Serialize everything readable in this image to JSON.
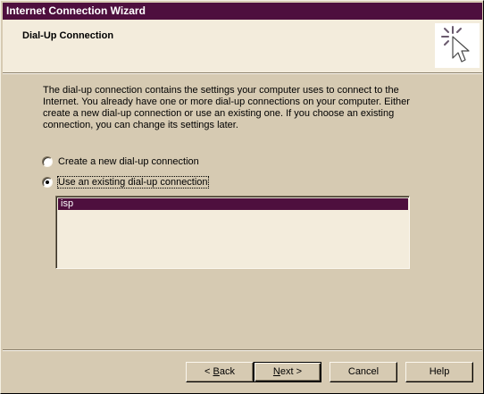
{
  "window": {
    "title": "Internet Connection Wizard"
  },
  "header": {
    "title": "Dial-Up Connection",
    "icon": "wizard-cursor-icon"
  },
  "description": "The dial-up connection contains the settings your computer uses to connect to the Internet. You already have one or more dial-up connections on your computer. Either create a new dial-up connection or use an existing one. If you choose an existing connection, you can change its settings later.",
  "options": {
    "create_new": {
      "label": "Create a new dial-up connection",
      "checked": false
    },
    "use_existing": {
      "label": "Use an existing dial-up connection",
      "checked": true
    }
  },
  "connections": {
    "items": [
      "isp"
    ],
    "selected": "isp"
  },
  "buttons": {
    "back_key": "B",
    "back_rest": "ack",
    "back_arrow": "<",
    "next_key": "N",
    "next_rest": "ext",
    "next_arrow": ">",
    "cancel": "Cancel",
    "help": "Help"
  },
  "colors": {
    "titlebar": "#4e0f3e",
    "dialog_face": "#d6cab2",
    "header_bg": "#f3ecdc",
    "selection": "#4e0f3e"
  }
}
